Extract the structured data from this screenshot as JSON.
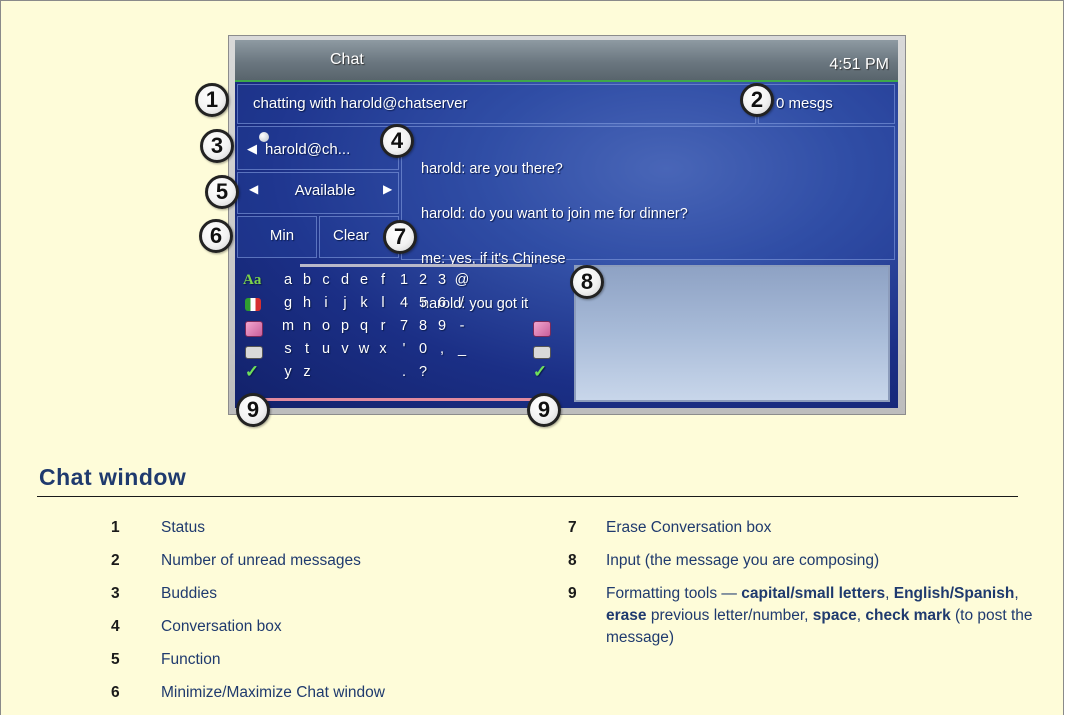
{
  "screen": {
    "title": "Chat",
    "clock": "4:51 PM",
    "status_text": "chatting with harold@chatserver",
    "unread_count": "0 mesgs",
    "buddy": "harold@ch...",
    "conversation": [
      "harold: are you there?",
      "harold: do you want to join me for dinner?",
      "me: yes, if it's Chinese",
      "harold: you got it"
    ],
    "function_value": "Available",
    "min_button": "Min",
    "clear_button": "Clear"
  },
  "keyboard": {
    "rows": [
      [
        "a",
        "b",
        "c",
        "d",
        "e",
        "f",
        "1",
        "2",
        "3",
        "@"
      ],
      [
        "g",
        "h",
        "i",
        "j",
        "k",
        "l",
        "4",
        "5",
        "6",
        "/"
      ],
      [
        "m",
        "n",
        "o",
        "p",
        "q",
        "r",
        "7",
        "8",
        "9",
        "-"
      ],
      [
        "s",
        "t",
        "u",
        "v",
        "w",
        "x",
        "'",
        "0",
        ",",
        "_"
      ],
      [
        "y",
        "z",
        "",
        "",
        "",
        "",
        ".",
        "?",
        "",
        ""
      ]
    ],
    "left_tools": [
      "capitals-icon",
      "language-icon",
      "erase-icon",
      "space-icon",
      "check-icon"
    ],
    "right_tools": [
      "",
      "",
      "erase-icon",
      "space-icon",
      "check-icon"
    ],
    "caps_label": "Aa",
    "check_glyph": "✓"
  },
  "callouts": [
    "1",
    "2",
    "3",
    "4",
    "5",
    "6",
    "7",
    "8",
    "9",
    "9"
  ],
  "legend": {
    "title": "Chat window",
    "left": [
      {
        "num": "1",
        "text": "Status"
      },
      {
        "num": "2",
        "text": "Number of unread messages"
      },
      {
        "num": "3",
        "text": "Buddies"
      },
      {
        "num": "4",
        "text": "Conversation box"
      },
      {
        "num": "5",
        "text": "Function"
      },
      {
        "num": "6",
        "text": "Minimize/Maximize Chat window"
      }
    ],
    "right": [
      {
        "num": "7",
        "text": "Erase Conversation box"
      },
      {
        "num": "8",
        "text": "Input (the message you are composing)"
      },
      {
        "num": "9",
        "parts": [
          {
            "t": "Formatting tools — ",
            "b": false
          },
          {
            "t": "capital/small letters",
            "b": true
          },
          {
            "t": ", ",
            "b": false
          },
          {
            "t": "English/Spanish",
            "b": true
          },
          {
            "t": ", ",
            "b": false
          },
          {
            "t": "erase",
            "b": true
          },
          {
            "t": " previous letter/number, ",
            "b": false
          },
          {
            "t": "space",
            "b": true
          },
          {
            "t": ", ",
            "b": false
          },
          {
            "t": "check mark",
            "b": true
          },
          {
            "t": " (to post the message)",
            "b": false
          }
        ]
      }
    ]
  },
  "colors": {
    "page_bg": "#fefcd9",
    "heading": "#1f3a6e",
    "screen_blue": "#1b2f86",
    "title_bar": "#6b7780",
    "accent_green": "#3ea84a"
  }
}
